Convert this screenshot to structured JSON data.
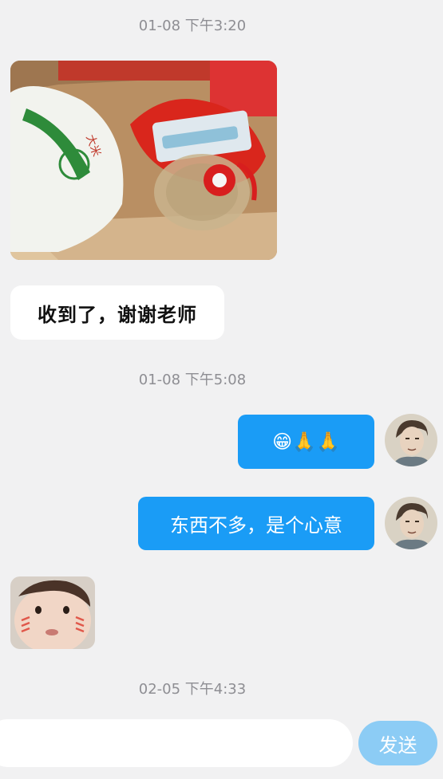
{
  "messages": {
    "ts1": "01-08 下午3:20",
    "ts2": "01-08 下午5:08",
    "ts3": "02-05 下午4:33",
    "received_text": "收到了，谢谢老师",
    "sent_1": "😁🙏🙏",
    "sent_2": "东西不多，是个心意"
  },
  "composer": {
    "send_label": "发送"
  },
  "colors": {
    "background": "#f1f1f2",
    "sent_bubble": "#1a9cf6",
    "send_button": "#8cccf5"
  },
  "icons": {
    "photo": "photo-image",
    "avatar": "user-avatar",
    "sticker": "baby-sticker"
  }
}
